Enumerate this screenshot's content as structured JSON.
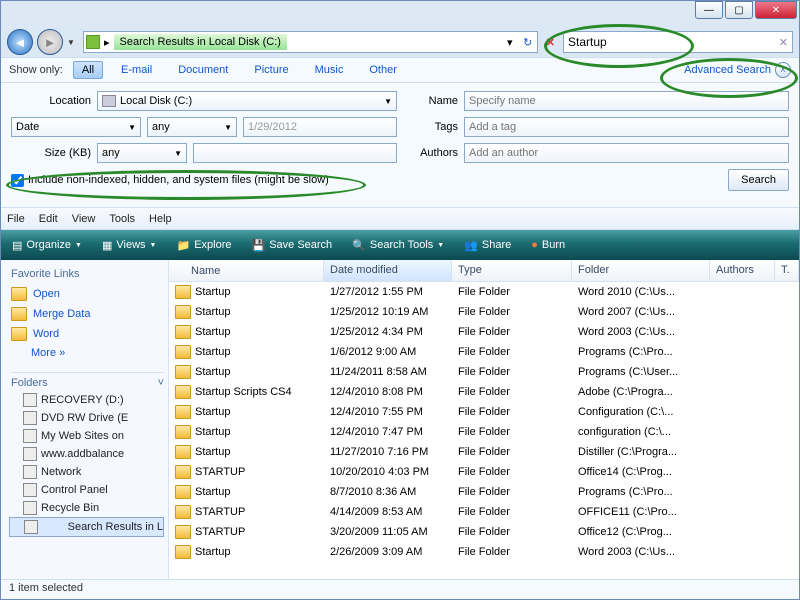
{
  "nav": {
    "address_segment": "Search Results in Local Disk (C:)",
    "search_value": "Startup"
  },
  "filters": {
    "show_only_label": "Show only:",
    "tabs": [
      "All",
      "E-mail",
      "Document",
      "Picture",
      "Music",
      "Other"
    ],
    "advanced_label": "Advanced Search"
  },
  "adv": {
    "location_label": "Location",
    "location_value": "Local Disk (C:)",
    "date_label": "Date",
    "date_rel": "any",
    "date_val": "1/29/2012",
    "size_label": "Size (KB)",
    "size_rel": "any",
    "name_label": "Name",
    "name_ph": "Specify name",
    "tags_label": "Tags",
    "tags_ph": "Add a tag",
    "authors_label": "Authors",
    "authors_ph": "Add an author",
    "include_label": "Include non-indexed, hidden, and system files (might be slow)",
    "search_btn": "Search"
  },
  "menus": [
    "File",
    "Edit",
    "View",
    "Tools",
    "Help"
  ],
  "cmds": {
    "organize": "Organize",
    "views": "Views",
    "explore": "Explore",
    "savesearch": "Save Search",
    "searchtools": "Search Tools",
    "share": "Share",
    "burn": "Burn"
  },
  "sidebar": {
    "fav_header": "Favorite Links",
    "fav": [
      "Open",
      "Merge Data",
      "Word"
    ],
    "more": "More  »",
    "fold_header": "Folders",
    "tree": [
      "RECOVERY (D:)",
      "DVD RW Drive (E",
      "My Web Sites on",
      "www.addbalance",
      "Network",
      "Control Panel",
      "Recycle Bin",
      "Search Results in L"
    ]
  },
  "columns": [
    "Name",
    "Date modified",
    "Type",
    "Folder",
    "Authors",
    "T."
  ],
  "rows": [
    {
      "name": "Startup",
      "date": "1/27/2012 1:55 PM",
      "type": "File Folder",
      "folder": "Word 2010 (C:\\Us..."
    },
    {
      "name": "Startup",
      "date": "1/25/2012 10:19 AM",
      "type": "File Folder",
      "folder": "Word 2007 (C:\\Us..."
    },
    {
      "name": "Startup",
      "date": "1/25/2012 4:34 PM",
      "type": "File Folder",
      "folder": "Word 2003 (C:\\Us..."
    },
    {
      "name": "Startup",
      "date": "1/6/2012 9:00 AM",
      "type": "File Folder",
      "folder": "Programs (C:\\Pro..."
    },
    {
      "name": "Startup",
      "date": "11/24/2011 8:58 AM",
      "type": "File Folder",
      "folder": "Programs (C:\\User..."
    },
    {
      "name": "Startup Scripts CS4",
      "date": "12/4/2010 8:08 PM",
      "type": "File Folder",
      "folder": "Adobe (C:\\Progra..."
    },
    {
      "name": "Startup",
      "date": "12/4/2010 7:55 PM",
      "type": "File Folder",
      "folder": "Configuration (C:\\..."
    },
    {
      "name": "Startup",
      "date": "12/4/2010 7:47 PM",
      "type": "File Folder",
      "folder": "configuration (C:\\..."
    },
    {
      "name": "Startup",
      "date": "11/27/2010 7:16 PM",
      "type": "File Folder",
      "folder": "Distiller (C:\\Progra..."
    },
    {
      "name": "STARTUP",
      "date": "10/20/2010 4:03 PM",
      "type": "File Folder",
      "folder": "Office14 (C:\\Prog..."
    },
    {
      "name": "Startup",
      "date": "8/7/2010 8:36 AM",
      "type": "File Folder",
      "folder": "Programs (C:\\Pro..."
    },
    {
      "name": "STARTUP",
      "date": "4/14/2009 8:53 AM",
      "type": "File Folder",
      "folder": "OFFICE11 (C:\\Pro..."
    },
    {
      "name": "STARTUP",
      "date": "3/20/2009 11:05 AM",
      "type": "File Folder",
      "folder": "Office12 (C:\\Prog..."
    },
    {
      "name": "Startup",
      "date": "2/26/2009 3:09 AM",
      "type": "File Folder",
      "folder": "Word 2003 (C:\\Us..."
    }
  ],
  "status": "1 item selected"
}
